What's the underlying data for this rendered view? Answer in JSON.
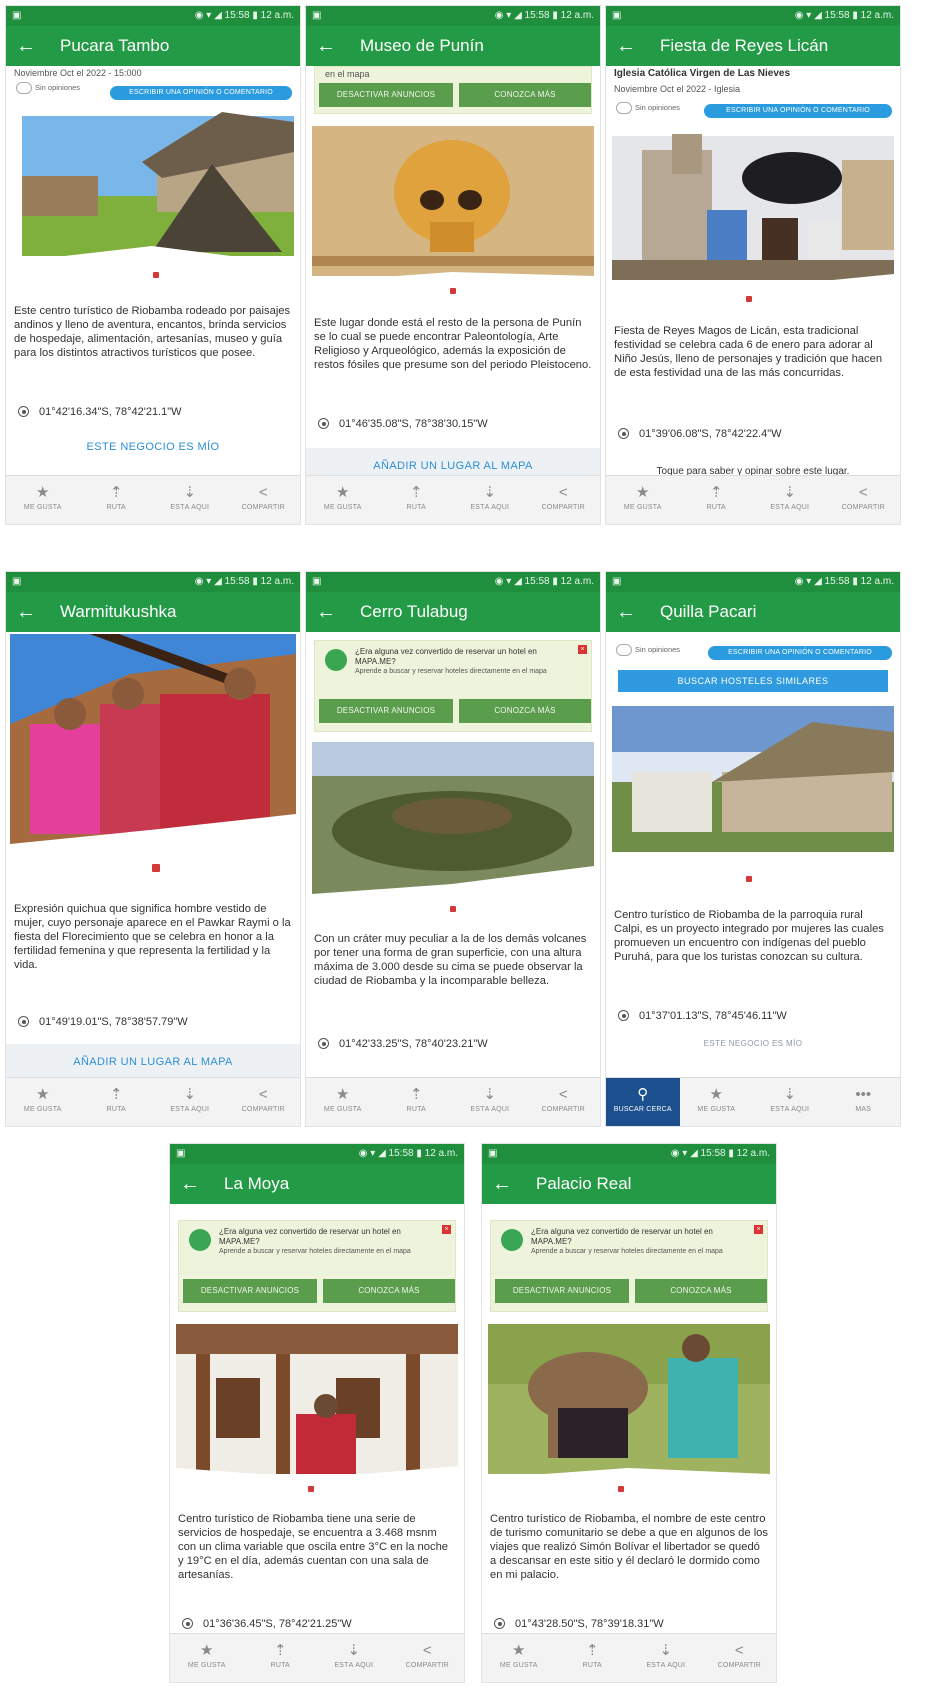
{
  "status": {
    "left": "▣",
    "right": "◉ ▾ ◢ 15:58 ▮ 12 a.m."
  },
  "nav_labels": [
    "ME GUSTA",
    "RUTA",
    "ESTÁ AQUÍ",
    "COMPARTIR"
  ],
  "nav_labels_alt": [
    "BUSCAR CERCA",
    "ME GUSTA",
    "ESTÁ AQUÍ",
    "MÁS"
  ],
  "ad": {
    "title": "¿Era alguna vez convertido de reservar un hotel en MAPA.ME?",
    "subtitle": "Aprende a buscar y reservar hoteles directamente en el mapa",
    "disable": "DESACTIVAR ANUNCIOS",
    "more": "CONOZCA MÁS"
  },
  "screens": {
    "pucara": {
      "title": "Pucara Tambo",
      "subline": "Noviembre Oct el 2022 - 15:000",
      "opinions": "Sin opiniones",
      "review_btn": "ESCRIBIR UNA OPINIÓN O COMENTARIO",
      "description": "Este centro turístico de Riobamba rodeado por paisajes andinos y lleno de aventura, encantos, brinda servicios de hospedaje, alimentación, artesanías, museo y guía para los distintos atractivos turísticos que posee.",
      "coord": "01°42'16.34\"S, 78°42'21.1\"W",
      "link": "ESTE NEGOCIO ES MÍO"
    },
    "museo": {
      "title": "Museo de Punín",
      "subline": "en el mapa",
      "description": "Este lugar donde está el resto de la persona de Punín se lo cual se puede encontrar Paleontología, Arte Religioso y Arqueológico, además la exposición de restos fósiles que presume son del periodo Pleistoceno.",
      "coord": "01°46'35.08\"S, 78°38'30.15\"W",
      "link": "AÑADIR UN LUGAR AL MAPA"
    },
    "reyes": {
      "title": "Fiesta de Reyes Licán",
      "subtitle": "Iglesia Católica Virgen de Las Nieves",
      "subline": "Noviembre Oct el 2022 - Iglesia",
      "opinions": "Sin opiniones",
      "review_btn": "ESCRIBIR UNA OPINIÓN O COMENTARIO",
      "description": "Fiesta de Reyes Magos de Licán, esta tradicional festividad se celebra cada 6 de enero para adorar al Niño Jesús, lleno de personajes y tradición que hacen de esta festividad una de las más concurridas.",
      "coord": "01°39'06.08\"S, 78°42'22.4\"W",
      "togo": "Toque para saber y opinar sobre este lugar."
    },
    "warmi": {
      "title": "Warmitukushka",
      "description": "Expresión quichua que significa hombre vestido de mujer, cuyo personaje aparece en el Pawkar Raymi o la fiesta del Florecimiento que se celebra en honor a la fertilidad femenina y que representa la fertilidad y la vida.",
      "coord": "01°49'19.01\"S, 78°38'57.79\"W",
      "link": "AÑADIR UN LUGAR AL MAPA"
    },
    "tulabug": {
      "title": "Cerro Tulabug",
      "description": "Con un cráter muy peculiar a la de los demás volcanes por tener una forma de gran superficie, con una altura máxima de 3.000 desde su cima se puede observar la ciudad de Riobamba y la incomparable belleza.",
      "coord": "01°42'33.25\"S, 78°40'23.21\"W"
    },
    "quilla": {
      "title": "Quilla Pacari",
      "opinions": "Sin opiniones",
      "review_btn": "ESCRIBIR UNA OPINIÓN O COMENTARIO",
      "hostels": "BUSCAR HOSTELES SIMILARES",
      "description": "Centro turístico de Riobamba de la parroquia rural Calpi, es un proyecto integrado por mujeres las cuales promueven un encuentro con indígenas del pueblo Puruhá, para que los turistas conozcan su cultura.",
      "coord": "01°37'01.13\"S, 78°45'46.11\"W",
      "link": "ESTE NEGOCIO ES MÍO"
    },
    "moya": {
      "title": "La Moya",
      "description": "Centro turístico de Riobamba tiene una serie de servicios de hospedaje, se encuentra a 3.468 msnm con un clima variable que oscila entre 3°C en la noche y 19°C en el día, además cuentan con una sala de artesanías.",
      "coord": "01°36'36.45\"S, 78°42'21.25\"W"
    },
    "palacio": {
      "title": "Palacio Real",
      "description": "Centro turístico de Riobamba, el nombre de este centro de turismo comunitario se debe a que en algunos de los viajes que realizó Simón Bolívar el libertador se quedó a descansar en este sitio y él declaró le dormido como en mi palacio.",
      "coord": "01°43'28.50\"S, 78°39'18.31\"W"
    }
  }
}
